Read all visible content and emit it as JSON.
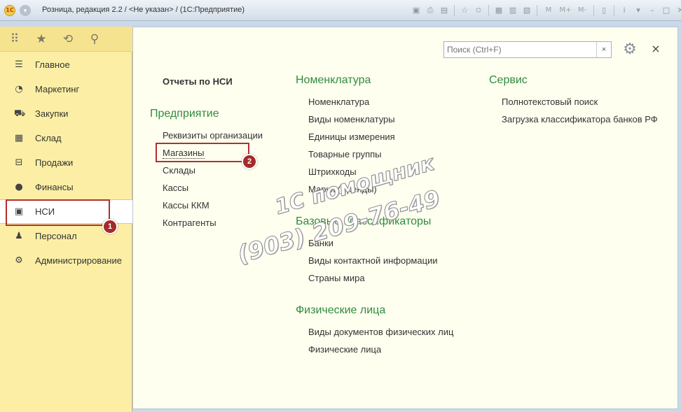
{
  "titlebar": {
    "title": "Розница, редакция 2.2 / <Не указан> / (1С:Предприятие)",
    "logo_text": "1С",
    "icons": [
      "save-icon",
      "print-icon",
      "preview-icon",
      "favorite-add-icon",
      "favorites-icon",
      "calendar-icon",
      "calculator-icon",
      "compare-icon"
    ],
    "memory_buttons": [
      "M",
      "M+",
      "M-"
    ],
    "info_icon": "i"
  },
  "sidebar": {
    "toolbar_icons": [
      "apps-grid-icon",
      "star-icon",
      "history-icon",
      "search-icon"
    ],
    "items": [
      {
        "label": "Главное",
        "icon": "menu-lines-icon"
      },
      {
        "label": "Маркетинг",
        "icon": "pie-chart-icon"
      },
      {
        "label": "Закупки",
        "icon": "cart-icon"
      },
      {
        "label": "Склад",
        "icon": "warehouse-icon"
      },
      {
        "label": "Продажи",
        "icon": "basket-icon"
      },
      {
        "label": "Финансы",
        "icon": "ruble-icon"
      },
      {
        "label": "НСИ",
        "icon": "documents-icon"
      },
      {
        "label": "Персонал",
        "icon": "person-icon"
      },
      {
        "label": "Администрирование",
        "icon": "gears-icon"
      }
    ],
    "active_item": "НСИ",
    "badge_1": "1"
  },
  "main": {
    "search_placeholder": "Поиск (Ctrl+F)",
    "search_clear": "×",
    "close": "×",
    "reports_title": "Отчеты по НСИ",
    "col1": {
      "title": "Предприятие",
      "links": [
        "Реквизиты организации",
        "Магазины",
        "Склады",
        "Кассы",
        "Кассы ККМ",
        "Контрагенты"
      ]
    },
    "badge_2": "2",
    "col2": {
      "groups": [
        {
          "title": "Номенклатура",
          "links": [
            "Номенклатура",
            "Виды номенклатуры",
            "Единицы измерения",
            "Товарные группы",
            "Штрихкоды",
            "Марки (Бренды)"
          ]
        },
        {
          "title": "Базовые классификаторы",
          "links": [
            "Банки",
            "Виды контактной информации",
            "Страны мира"
          ]
        },
        {
          "title": "Физические лица",
          "links": [
            "Виды документов физических лиц",
            "Физические лица"
          ]
        }
      ]
    },
    "col3": {
      "title": "Сервис",
      "links": [
        "Полнотекстовый поиск",
        "Загрузка классификатора банков РФ"
      ]
    },
    "watermark": {
      "line1": "1С помощник",
      "line2": "(903) 209-76-49"
    }
  },
  "colors": {
    "sidebar_bg": "#fcefa5",
    "main_bg": "#fffff0",
    "group_title": "#2f8c3c",
    "annotation_red": "#a52a2a"
  }
}
